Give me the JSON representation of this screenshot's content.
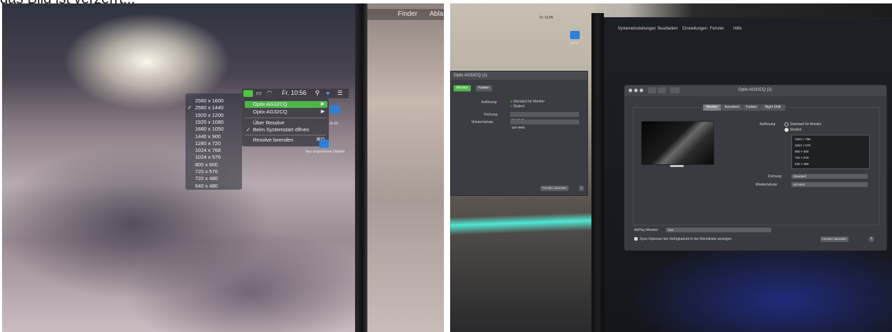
{
  "caption": "das Bild ist verzerrt...",
  "left_photo": {
    "finder": {
      "apple": "",
      "finder_label": "Finder",
      "next_label": "Abla"
    },
    "menubar": {
      "time": "Fr. 10:56",
      "search_icon": "search-icon",
      "accent": "#4ec443"
    },
    "resolutions": [
      {
        "label": "2560 x 1600",
        "checked": false
      },
      {
        "label": "2560 x 1440",
        "checked": true
      },
      {
        "label": "1920 x 1200",
        "checked": false
      },
      {
        "label": "1920 x 1080",
        "checked": false
      },
      {
        "label": "1680 x 1050",
        "checked": false
      },
      {
        "label": "1440 x 900",
        "checked": false
      },
      {
        "label": "1280 x 720",
        "checked": false
      },
      {
        "label": "1024 x 768",
        "checked": false
      },
      {
        "label": "1024 x 576",
        "checked": false
      },
      {
        "label": "800 x 600",
        "checked": false
      },
      {
        "label": "720 x 576",
        "checked": false
      },
      {
        "label": "720 x 480",
        "checked": false
      },
      {
        "label": "640 x 480",
        "checked": false
      }
    ],
    "app_menu": {
      "monitor_1": "Optix AG32CQ",
      "monitor_2": "Optix AG32CQ",
      "about": "Über Resolve",
      "launch_at_login": "Beim Systemstart öffnen",
      "quit": "Resolve beenden",
      "quit_shortcut": "⌘Q",
      "check": "✓"
    },
    "desktop_labels": {
      "side": "ck.sfx",
      "folder": "Neu angeordnete Objekte"
    }
  },
  "right_photo": {
    "left_window": {
      "title": "Optix AG32CQ (1)",
      "tab_monitor": "Monitor",
      "tab_colors": "Farben",
      "resolution_label": "Auflösung:",
      "opt_default": "Standard für Monitor",
      "opt_scaled": "Skaliert",
      "rotation_label": "Drehung:",
      "rotation_value": "Standard",
      "refresh_label": "Wiederholrate:",
      "refresh_value": "120 Hertz",
      "gather_button": "Fenster sammeln"
    },
    "menubar": {
      "apple": "",
      "items": [
        "Systemeinstellungen",
        "Bearbeiten",
        "Einstellungen",
        "Fenster",
        "Hilfe"
      ]
    },
    "right_menubar_time": "Fr. 11:06",
    "desktop_label": "Mudo",
    "main_window": {
      "title": "Optix AG32CQ (2)",
      "tabs": [
        "Monitor",
        "Anordnen",
        "Farben",
        "Night Shift"
      ],
      "selected_tab": "Monitor",
      "resolution_label": "Auflösung:",
      "opt_default": "Standard für Monitor",
      "opt_scaled": "Skaliert",
      "resolution_list": [
        "1024 × 768",
        "1024 × 576",
        "800 × 600",
        "720 × 576",
        "640 × 480"
      ],
      "rotation_label": "Drehung:",
      "rotation_value": "Standard",
      "refresh_label": "Wiederholrate:",
      "refresh_value": "60 Hertz",
      "airplay_label": "AirPlay-Monitor:",
      "airplay_value": "Aus",
      "sync_label": "Sync-Optionen bei Verfügbarkeit in der Menüleiste anzeigen",
      "gather_button": "Fenster sammeln",
      "help": "?"
    }
  }
}
